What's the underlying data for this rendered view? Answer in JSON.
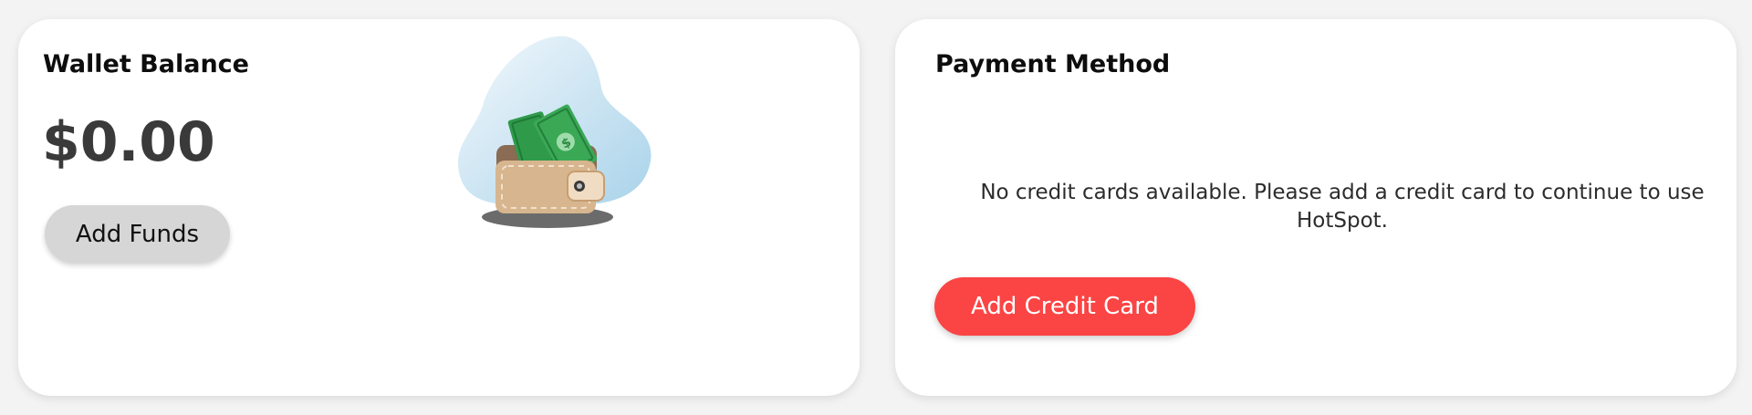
{
  "wallet": {
    "title": "Wallet Balance",
    "balance": "$0.00",
    "add_funds_label": "Add Funds",
    "illustration_icon": "wallet-with-cash-icon"
  },
  "payment": {
    "title": "Payment Method",
    "empty_message": "No credit cards available. Please add a credit card to continue to use HotSpot.",
    "add_card_label": "Add Credit Card"
  },
  "colors": {
    "page_background": "#f3f3f3",
    "card_background": "#ffffff",
    "balance_text": "#3a3a3a",
    "add_funds_button": "#d6d6d6",
    "add_card_button": "#fb4444",
    "add_card_text": "#ffffff"
  }
}
